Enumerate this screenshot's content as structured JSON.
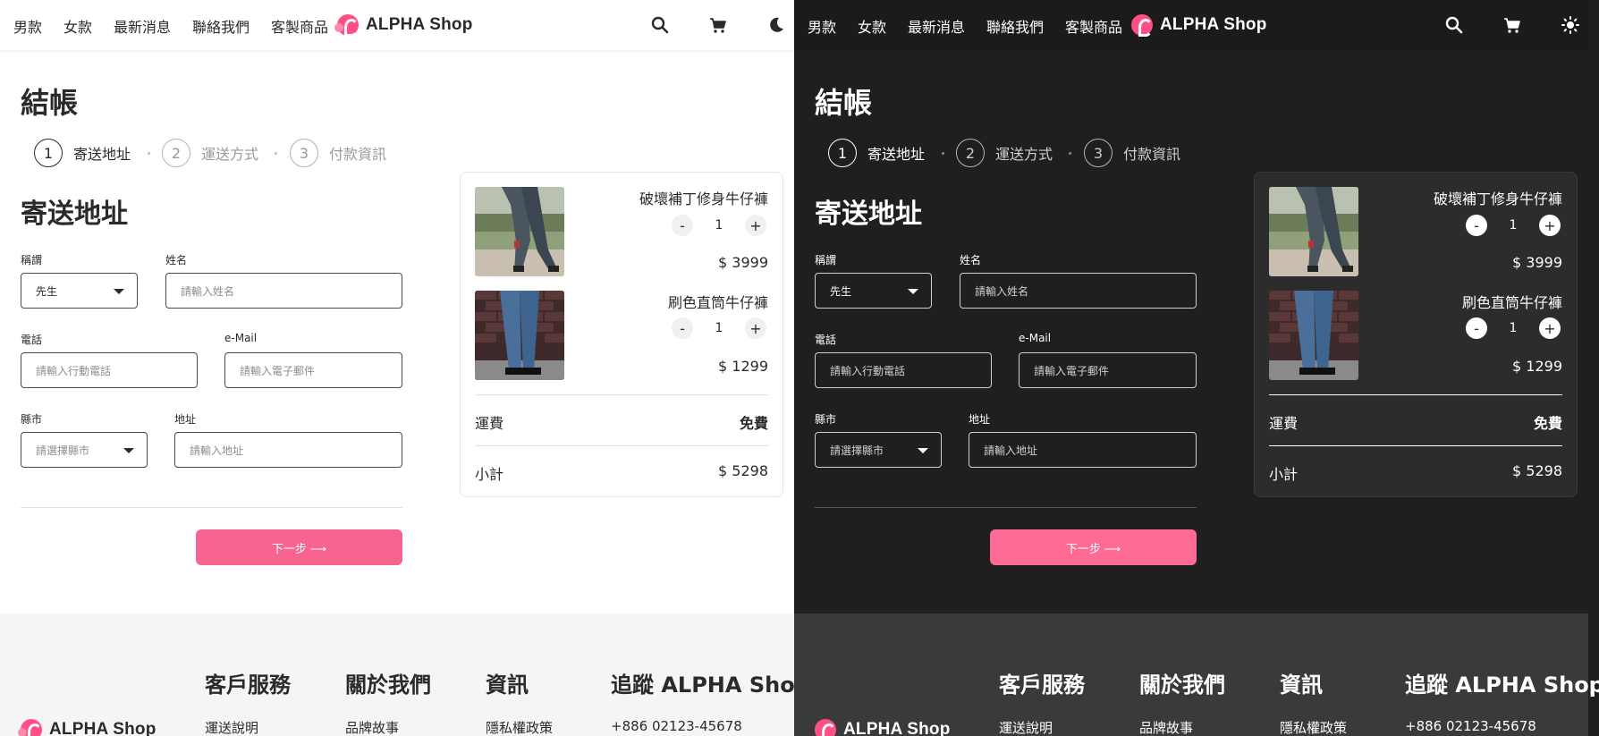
{
  "nav": {
    "items": [
      "男款",
      "女款",
      "最新消息",
      "聯絡我們",
      "客製商品"
    ],
    "logo_text": "ALPHA Shop"
  },
  "checkout": {
    "title": "結帳",
    "steps": [
      {
        "num": "1",
        "label": "寄送地址"
      },
      {
        "num": "2",
        "label": "運送方式"
      },
      {
        "num": "3",
        "label": "付款資訊"
      }
    ],
    "section_title": "寄送地址"
  },
  "form": {
    "salutation_label": "稱謂",
    "salutation_value": "先生",
    "name_label": "姓名",
    "name_placeholder": "請輸入姓名",
    "phone_label": "電話",
    "phone_placeholder": "請輸入行動電話",
    "email_label": "e-Mail",
    "email_placeholder": "請輸入電子郵件",
    "city_label": "縣市",
    "city_placeholder": "請選擇縣市",
    "address_label": "地址",
    "address_placeholder": "請輸入地址"
  },
  "next_button": "下一步 ⟶",
  "cart": {
    "items": [
      {
        "name": "破壞補丁修身牛仔褲",
        "quantity": "1",
        "price": "$ 3999"
      },
      {
        "name": "刷色直筒牛仔褲",
        "quantity": "1",
        "price": "$ 1299"
      }
    ],
    "minus": "-",
    "plus": "+",
    "shipping_label": "運費",
    "shipping_value": "免費",
    "subtotal_label": "小計",
    "subtotal_value": "$ 5298"
  },
  "footer": {
    "headings": [
      "客戶服務",
      "關於我們",
      "資訊",
      "追蹤 ALPHA Shop"
    ],
    "links": [
      "運送說明",
      "品牌故事",
      "隱私權政策",
      "+886 02123-45678"
    ],
    "logo_text": "ALPHA Shop"
  },
  "colors": {
    "accent": "#f6648f",
    "light_bg": "#ffffff",
    "dark_bg": "#1f1f1f"
  },
  "icons": {
    "search": "search-icon",
    "cart": "cart-icon",
    "theme_light": "moon-icon",
    "theme_dark": "sun-icon"
  }
}
